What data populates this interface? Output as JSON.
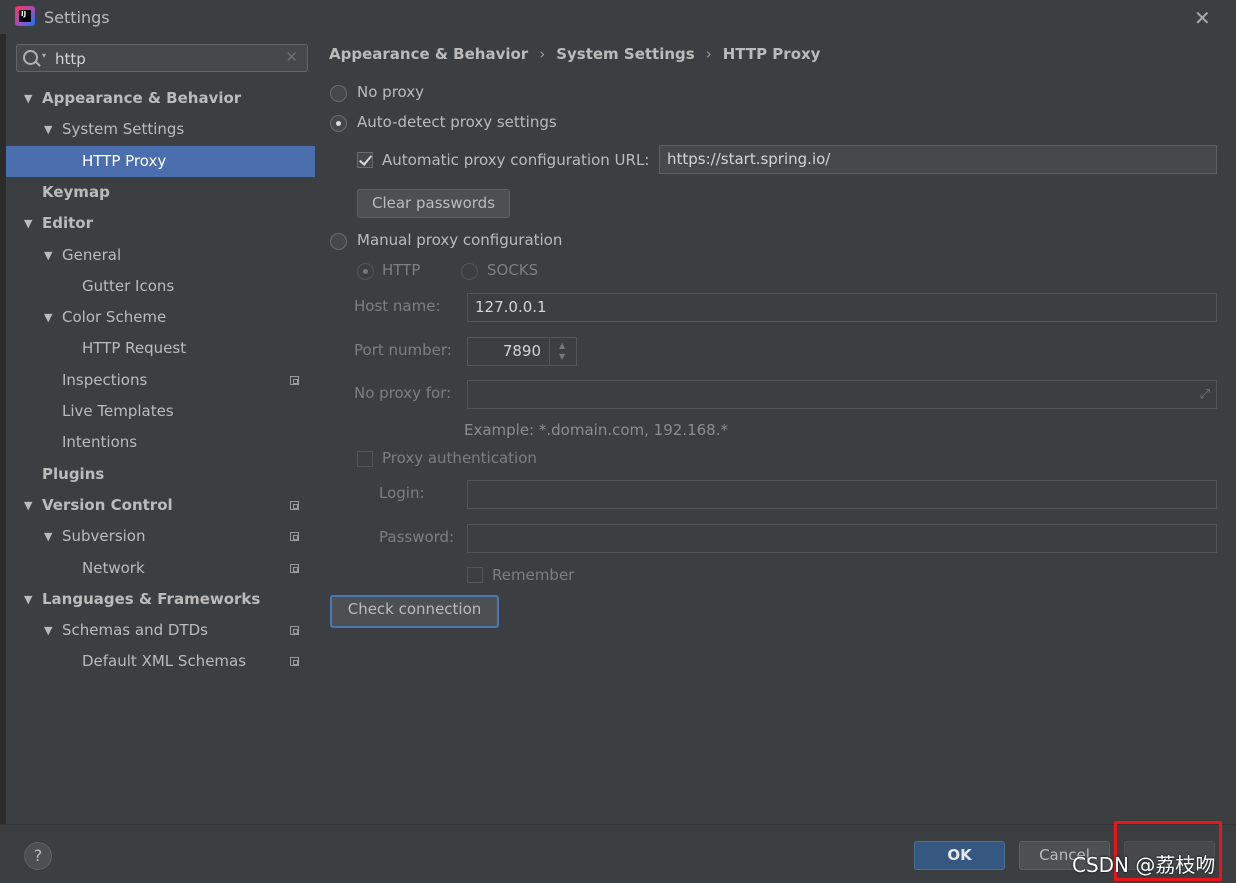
{
  "window": {
    "title": "Settings"
  },
  "search": {
    "value": "http"
  },
  "tree": [
    {
      "label": "Appearance & Behavior",
      "level": 0,
      "expanded": true,
      "bold": true
    },
    {
      "label": "System Settings",
      "level": 1,
      "expanded": true
    },
    {
      "label": "HTTP Proxy",
      "level": 2,
      "selected": true
    },
    {
      "label": "Keymap",
      "level": 0,
      "bold": true
    },
    {
      "label": "Editor",
      "level": 0,
      "expanded": true,
      "bold": true
    },
    {
      "label": "General",
      "level": 1,
      "expanded": true
    },
    {
      "label": "Gutter Icons",
      "level": 2
    },
    {
      "label": "Color Scheme",
      "level": 1,
      "expanded": true
    },
    {
      "label": "HTTP Request",
      "level": 2
    },
    {
      "label": "Inspections",
      "level": 1,
      "project": true
    },
    {
      "label": "Live Templates",
      "level": 1
    },
    {
      "label": "Intentions",
      "level": 1
    },
    {
      "label": "Plugins",
      "level": 0,
      "bold": true
    },
    {
      "label": "Version Control",
      "level": 0,
      "expanded": true,
      "bold": true,
      "project": true
    },
    {
      "label": "Subversion",
      "level": 1,
      "expanded": true,
      "project": true
    },
    {
      "label": "Network",
      "level": 2,
      "project": true
    },
    {
      "label": "Languages & Frameworks",
      "level": 0,
      "expanded": true,
      "bold": true
    },
    {
      "label": "Schemas and DTDs",
      "level": 1,
      "expanded": true,
      "project": true
    },
    {
      "label": "Default XML Schemas",
      "level": 2,
      "project": true
    }
  ],
  "breadcrumb": {
    "items": [
      "Appearance & Behavior",
      "System Settings",
      "HTTP Proxy"
    ]
  },
  "proxy": {
    "no_proxy_label": "No proxy",
    "auto_detect_label": "Auto-detect proxy settings",
    "auto_config_url_label": "Automatic proxy configuration URL:",
    "auto_config_url_value": "https://start.spring.io/",
    "clear_passwords_label": "Clear passwords",
    "manual_label": "Manual proxy configuration",
    "http_label": "HTTP",
    "socks_label": "SOCKS",
    "host_label": "Host name:",
    "host_value": "127.0.0.1",
    "port_label": "Port number:",
    "port_value": "7890",
    "no_proxy_for_label": "No proxy for:",
    "no_proxy_for_value": "",
    "example_hint": "Example: *.domain.com, 192.168.*",
    "auth_label": "Proxy authentication",
    "login_label": "Login:",
    "login_value": "",
    "password_label": "Password:",
    "password_value": "",
    "remember_label": "Remember",
    "check_connection_label": "Check connection",
    "selected_mode": "auto-detect",
    "auto_config_url_checked": true
  },
  "footer": {
    "help_label": "?",
    "ok_label": "OK",
    "cancel_label": "Cancel",
    "watermark": "CSDN @荔枝吻"
  },
  "colors": {
    "selection": "#4b6eaf",
    "highlight_box": "#e8161b"
  }
}
